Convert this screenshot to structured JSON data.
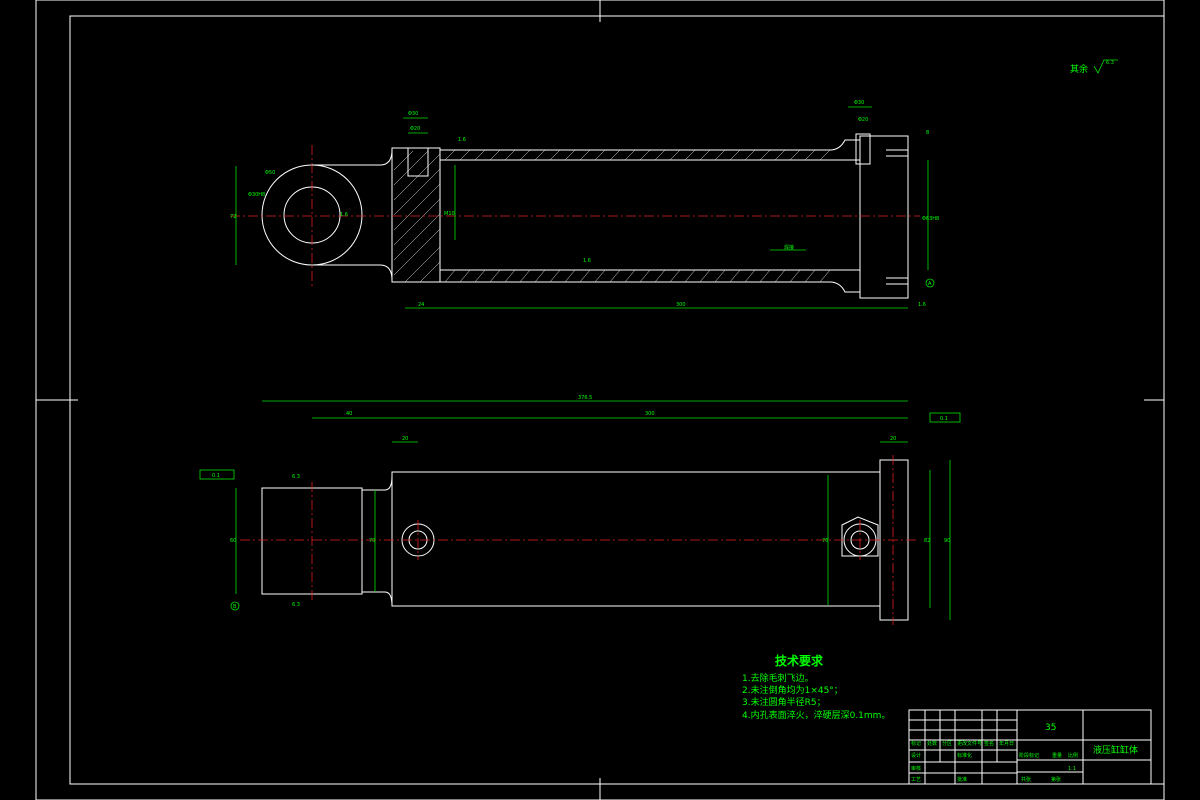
{
  "roughness_note": {
    "label": "其余",
    "value": "6.3"
  },
  "top_view": {
    "dim_hole_outer": "Φ30",
    "dim_hole_inner": "Φ20",
    "dim_ra_top": "1.6",
    "dim_ra_mid": "1.6",
    "dim_ra_bottom": "1.6",
    "dim_eye": "Φ50",
    "dim_eye_bore": "Φ30H8",
    "dim_height": "72",
    "dim_small": "M10",
    "dim_bore_label": "Φ63H8",
    "dim_left_len": "24",
    "dim_main_len": "300",
    "leader_label": "焊接",
    "datum_a": "A",
    "dim_right_1": "8",
    "dim_right_2": "1.6"
  },
  "bottom_view": {
    "dim_overall": "376.5",
    "dim_40": "40",
    "dim_300": "300",
    "dim_20_left": "20",
    "dim_20_right": "20",
    "dim_ra_left": "6.3",
    "dim_ra_bottom": "6.3",
    "tol_left": "0.1",
    "tol_right": "0.1",
    "datum_b": "B",
    "dim_height_left": "60",
    "dim_height_mid": "70",
    "dim_height_r1": "76",
    "dim_height_r2": "82",
    "dim_height_r3": "90"
  },
  "tech_requirements": {
    "title": "技术要求",
    "items": [
      "1.去除毛刺飞边。",
      "2.未注倒角均为1×45°；",
      "3.未注圆角半径R5；",
      "4.内孔表面淬火，淬硬层深0.1mm。"
    ]
  },
  "title_block": {
    "material": "35",
    "part_name": "液压缸缸体",
    "scale": "1:1",
    "labels": [
      "标记",
      "处数",
      "分区",
      "更改文件号",
      "签名",
      "年月日",
      "设计",
      "标准化",
      "审核",
      "工艺",
      "批准",
      "阶段标记",
      "重量",
      "比例",
      "共张",
      "第张"
    ]
  }
}
